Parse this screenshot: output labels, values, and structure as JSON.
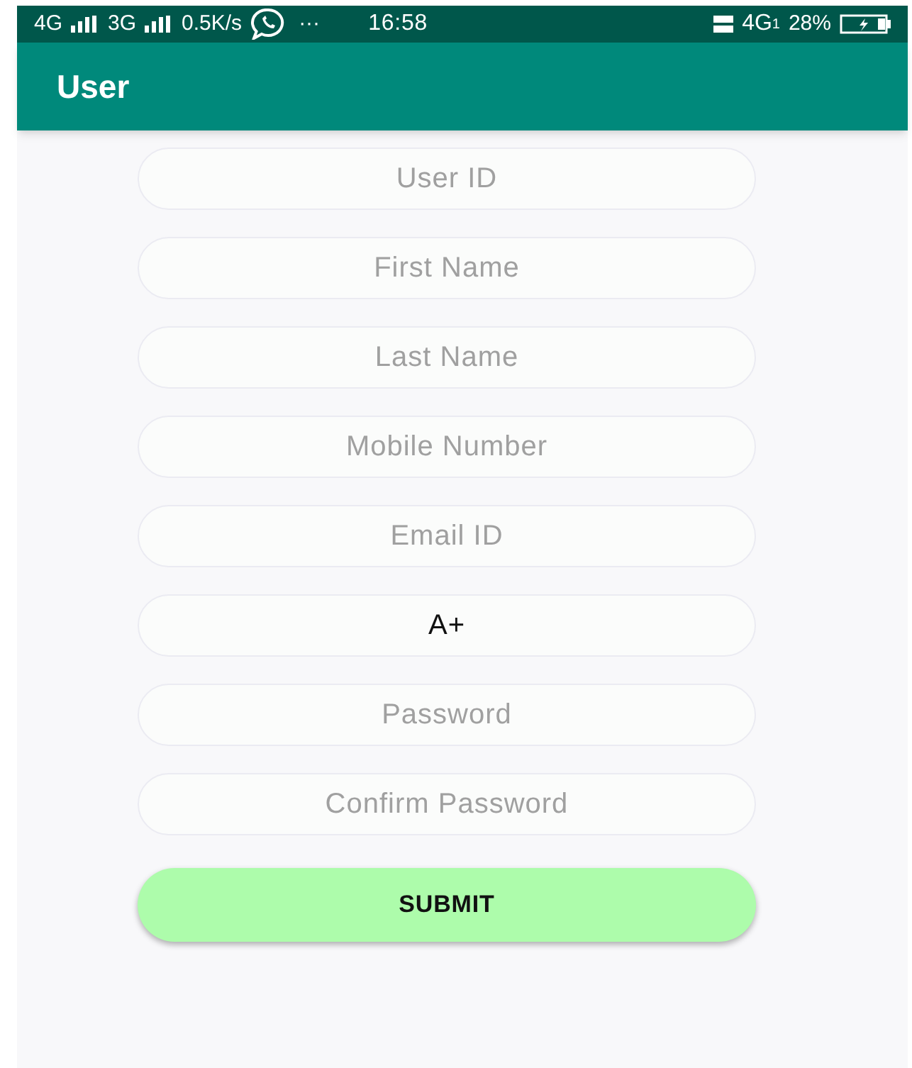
{
  "status_bar": {
    "network_1": "4G",
    "network_2": "3G",
    "speed": "0.5K/s",
    "more": "···",
    "time": "16:58",
    "network_3": "4G",
    "sim": "1",
    "battery": "28%"
  },
  "app_bar": {
    "title": "User"
  },
  "fields": [
    {
      "kind": "placeholder",
      "placeholder": "User ID"
    },
    {
      "kind": "placeholder",
      "placeholder": "First Name"
    },
    {
      "kind": "placeholder",
      "placeholder": "Last Name"
    },
    {
      "kind": "placeholder",
      "placeholder": "Mobile Number"
    },
    {
      "kind": "placeholder",
      "placeholder": "Email ID"
    },
    {
      "kind": "value",
      "value": "A+"
    },
    {
      "kind": "placeholder",
      "placeholder": "Password"
    },
    {
      "kind": "placeholder",
      "placeholder": "Confirm Password"
    }
  ],
  "submit_button": "SUBMIT"
}
